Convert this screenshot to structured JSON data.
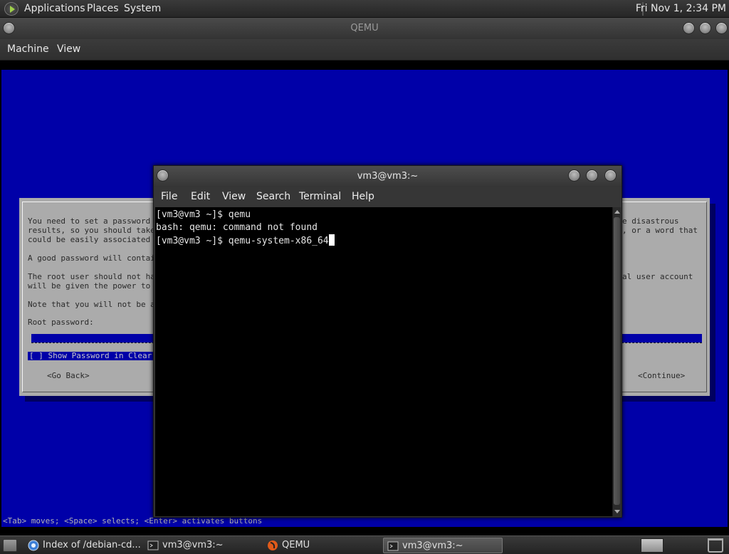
{
  "top_panel": {
    "menus": [
      "Applications",
      "Places",
      "System"
    ],
    "clock": "Fri Nov 1, 2:34 PM"
  },
  "qemu": {
    "title": "QEMU",
    "menus": [
      "Machine",
      "View"
    ]
  },
  "guest": {
    "dialog_lines_left": [
      "You need to set a password",
      "results, so you should take",
      "could be easily associated",
      "",
      "A good password will contain",
      "",
      "The root user should not hav",
      "will be given the power to b",
      "",
      "Note that you will not be ab"
    ],
    "dialog_lines_right": [
      "e disastrous",
      ", or a word that",
      "",
      "",
      "",
      "",
      "al user account",
      "",
      "",
      ""
    ],
    "root_password_label": "Root password:",
    "show_password_checkbox": "[ ] Show Password in Clear",
    "go_back_button": "<Go Back>",
    "continue_button": "<Continue>",
    "status_hint": "<Tab> moves; <Space> selects; <Enter> activates buttons"
  },
  "terminal": {
    "title": "vm3@vm3:~",
    "menus": [
      "File",
      "Edit",
      "View",
      "Search",
      "Terminal",
      "Help"
    ],
    "lines": [
      "[vm3@vm3 ~]$ qemu",
      "bash: qemu: command not found",
      "[vm3@vm3 ~]$ qemu-system-x86_64"
    ]
  },
  "taskbar": {
    "tasks": [
      "Index of /debian-cd...",
      "vm3@vm3:~",
      "QEMU",
      "vm3@vm3:~"
    ]
  },
  "colors": {
    "guest_blue": "#0000a8",
    "dialog_gray": "#ababab"
  }
}
